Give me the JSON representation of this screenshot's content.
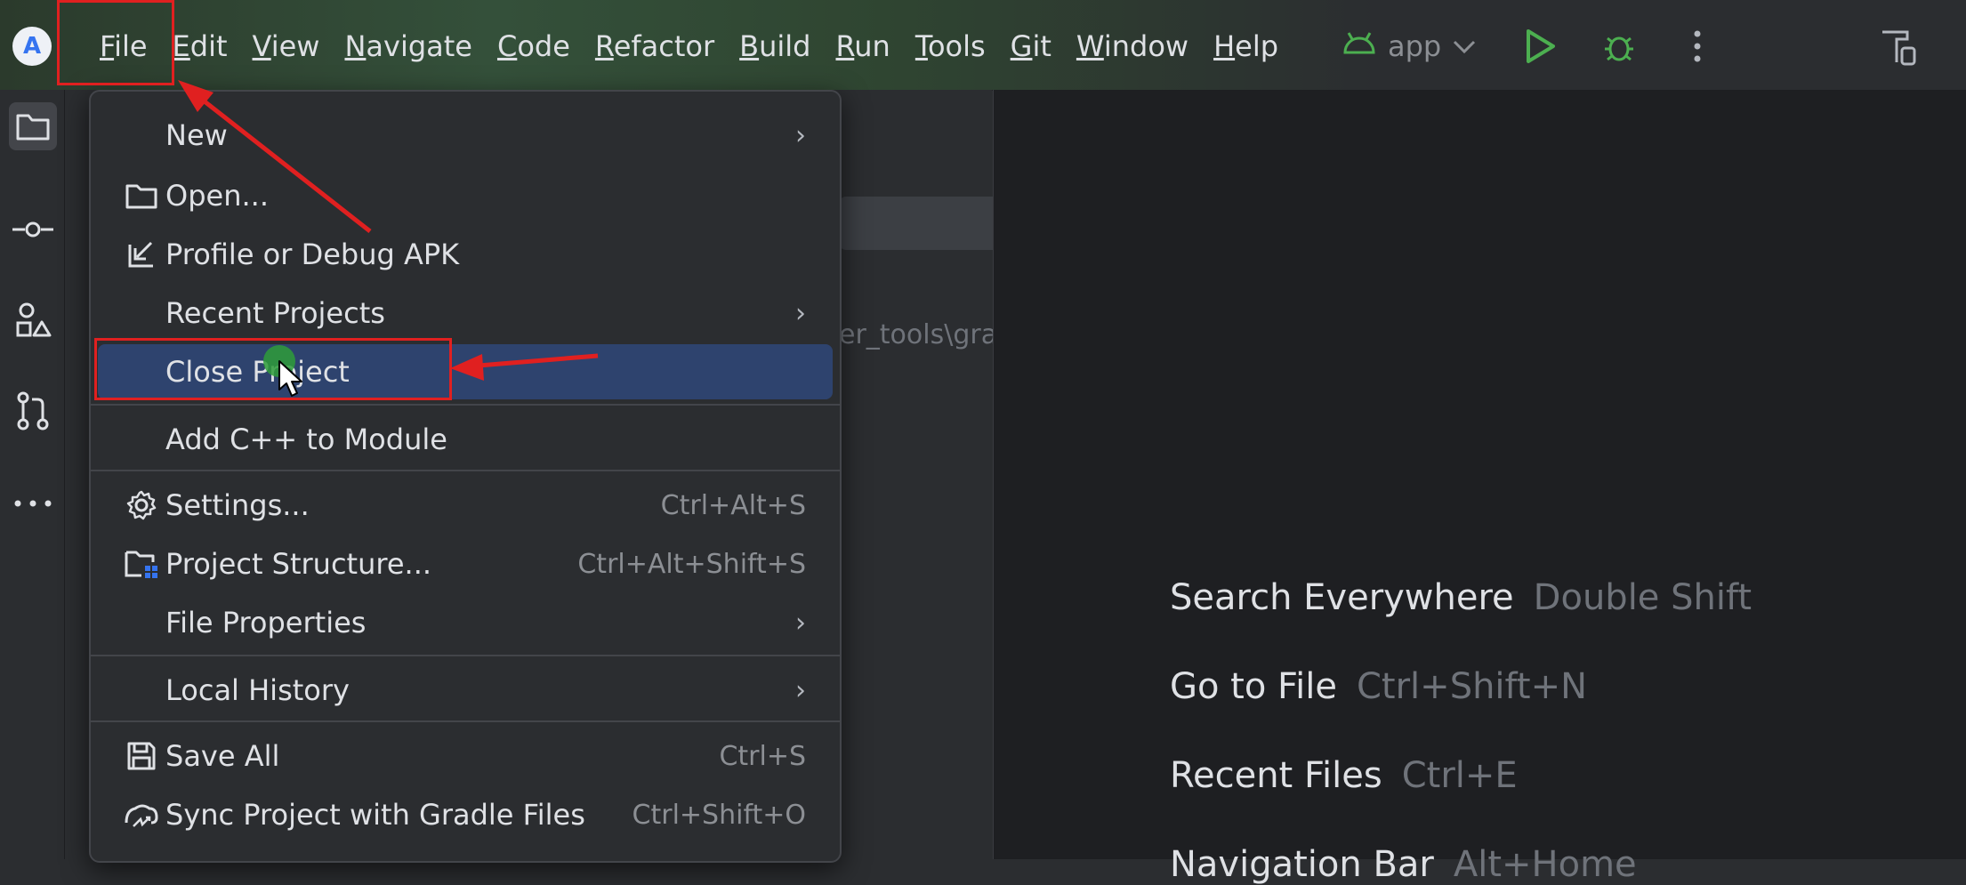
{
  "menubar": {
    "items": [
      {
        "label": "File",
        "u": "F",
        "rest": "ile"
      },
      {
        "label": "Edit",
        "u": "E",
        "rest": "dit"
      },
      {
        "label": "View",
        "u": "V",
        "rest": "iew"
      },
      {
        "label": "Navigate",
        "u": "N",
        "rest": "avigate"
      },
      {
        "label": "Code",
        "u": "C",
        "rest": "ode"
      },
      {
        "label": "Refactor",
        "u": "R",
        "rest": "efactor"
      },
      {
        "label": "Build",
        "u": "B",
        "rest": "uild"
      },
      {
        "label": "Run",
        "u": "R",
        "rest": "un"
      },
      {
        "label": "Tools",
        "u": "T",
        "rest": "ools"
      },
      {
        "label": "Git",
        "u": "G",
        "rest": "it"
      },
      {
        "label": "Window",
        "u": "W",
        "rest": "indow"
      },
      {
        "label": "Help",
        "u": "H",
        "rest": "elp"
      }
    ]
  },
  "run_config": {
    "label": "app"
  },
  "panel": {
    "path": "er_tools\\grad"
  },
  "file_menu": {
    "new": "New",
    "open": "Open...",
    "profile_apk": "Profile or Debug APK",
    "recent_projects": "Recent Projects",
    "close_project": "Close Project",
    "add_cpp": "Add C++ to Module",
    "settings": "Settings...",
    "settings_shortcut": "Ctrl+Alt+S",
    "project_structure": "Project Structure...",
    "project_structure_shortcut": "Ctrl+Alt+Shift+S",
    "file_properties": "File Properties",
    "local_history": "Local History",
    "save_all": "Save All",
    "save_all_shortcut": "Ctrl+S",
    "sync_gradle": "Sync Project with Gradle Files",
    "sync_gradle_shortcut": "Ctrl+Shift+O"
  },
  "editor_hints": [
    {
      "label": "Search Everywhere",
      "shortcut": "Double Shift"
    },
    {
      "label": "Go to File",
      "shortcut": "Ctrl+Shift+N"
    },
    {
      "label": "Recent Files",
      "shortcut": "Ctrl+E"
    },
    {
      "label": "Navigation Bar",
      "shortcut": "Alt+Home"
    }
  ],
  "colors": {
    "accent_selection": "#2e436e",
    "annotation_red": "#e02020",
    "run_green": "#4caf50"
  }
}
